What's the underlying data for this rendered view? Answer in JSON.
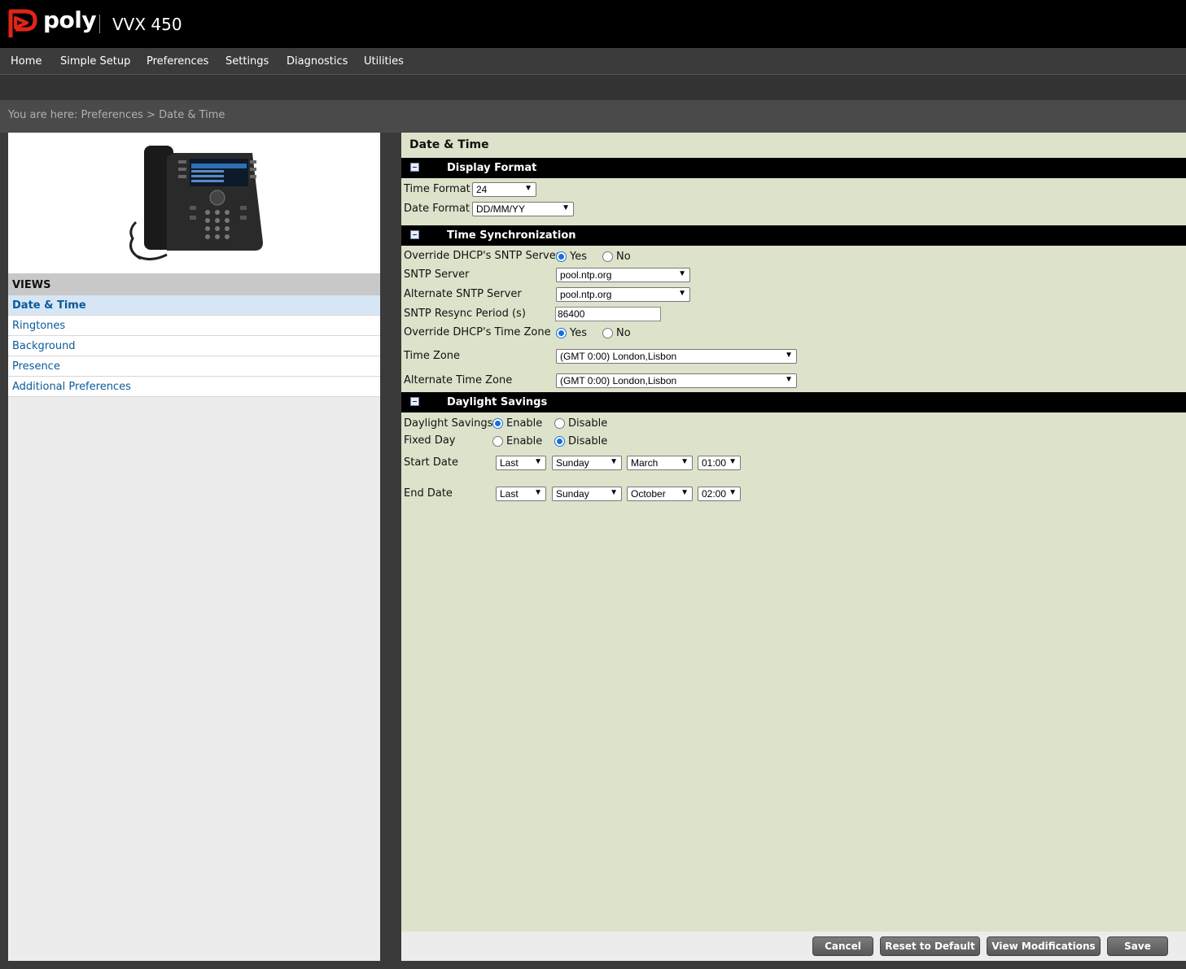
{
  "header": {
    "brand": "poly",
    "model": "VVX 450"
  },
  "nav": [
    "Home",
    "Simple Setup",
    "Preferences",
    "Settings",
    "Diagnostics",
    "Utilities"
  ],
  "breadcrumb": "You are here: Preferences > Date & Time",
  "views": {
    "title": "VIEWS",
    "items": [
      "Date & Time",
      "Ringtones",
      "Background",
      "Presence",
      "Additional Preferences"
    ]
  },
  "page_title": "Date & Time",
  "display_format": {
    "title": "Display Format",
    "time_format_label": "Time Format",
    "time_format_value": "24",
    "date_format_label": "Date Format",
    "date_format_value": "DD/MM/YY"
  },
  "time_sync": {
    "title": "Time Synchronization",
    "override_sntp_label": "Override DHCP's SNTP Server",
    "yes": "Yes",
    "no": "No",
    "sntp_server_label": "SNTP Server",
    "sntp_server_value": "pool.ntp.org",
    "alt_sntp_label": "Alternate SNTP Server",
    "alt_sntp_value": "pool.ntp.org",
    "resync_label": "SNTP Resync Period (s)",
    "resync_value": "86400",
    "override_tz_label": "Override DHCP's Time Zone",
    "tz_label": "Time Zone",
    "tz_value": "(GMT 0:00) London,Lisbon",
    "alt_tz_label": "Alternate Time Zone",
    "alt_tz_value": "(GMT 0:00) London,Lisbon"
  },
  "daylight": {
    "title": "Daylight Savings",
    "ds_label": "Daylight Savings",
    "fixed_label": "Fixed Day",
    "enable": "Enable",
    "disable": "Disable",
    "start_label": "Start Date",
    "start": {
      "week": "Last",
      "day": "Sunday",
      "month": "March",
      "time": "01:00"
    },
    "end_label": "End Date",
    "end": {
      "week": "Last",
      "day": "Sunday",
      "month": "October",
      "time": "02:00"
    }
  },
  "buttons": {
    "cancel": "Cancel",
    "reset": "Reset to Default",
    "view_mods": "View Modifications",
    "save": "Save"
  }
}
